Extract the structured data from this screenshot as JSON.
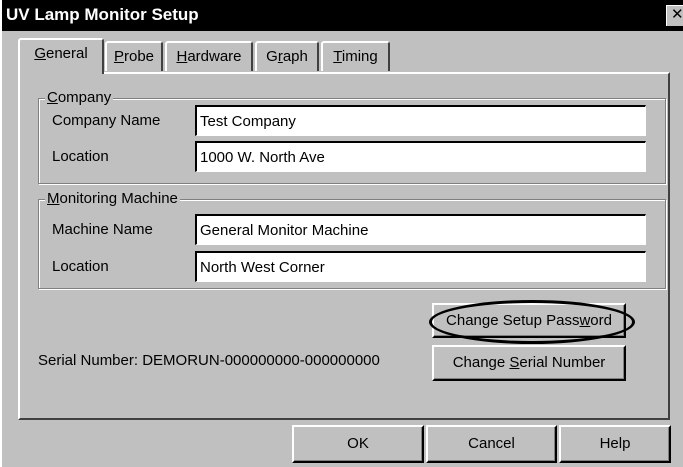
{
  "window": {
    "title": "UV Lamp Monitor Setup",
    "close_glyph": "✕"
  },
  "tabs": [
    {
      "prefix": "",
      "key": "G",
      "rest": "eneral"
    },
    {
      "prefix": "",
      "key": "P",
      "rest": "robe"
    },
    {
      "prefix": "",
      "key": "H",
      "rest": "ardware"
    },
    {
      "prefix": "G",
      "key": "r",
      "rest": "aph"
    },
    {
      "prefix": "",
      "key": "T",
      "rest": "iming"
    }
  ],
  "company": {
    "legend_key": "C",
    "legend_rest": "ompany",
    "name_label": "Company Name",
    "name_value": "Test Company",
    "location_label": "Location",
    "location_value": "1000 W. North Ave"
  },
  "machine": {
    "legend_key": "M",
    "legend_rest": "onitoring Machine",
    "name_label": "Machine Name",
    "name_value": "General Monitor Machine",
    "location_label": "Location",
    "location_value": "North West Corner"
  },
  "serial_number_text": "Serial Number: DEMORUN-000000000-000000000",
  "buttons": {
    "change_password": {
      "prefix": "Change Setup Pass",
      "key": "w",
      "rest": "ord"
    },
    "change_serial": {
      "prefix": "Change ",
      "key": "S",
      "rest": "erial Number"
    },
    "ok": "OK",
    "cancel": "Cancel",
    "help": "Help"
  },
  "colors": {
    "title_bar": "#000000",
    "face": "#c0c0c0",
    "field": "#ffffff"
  }
}
